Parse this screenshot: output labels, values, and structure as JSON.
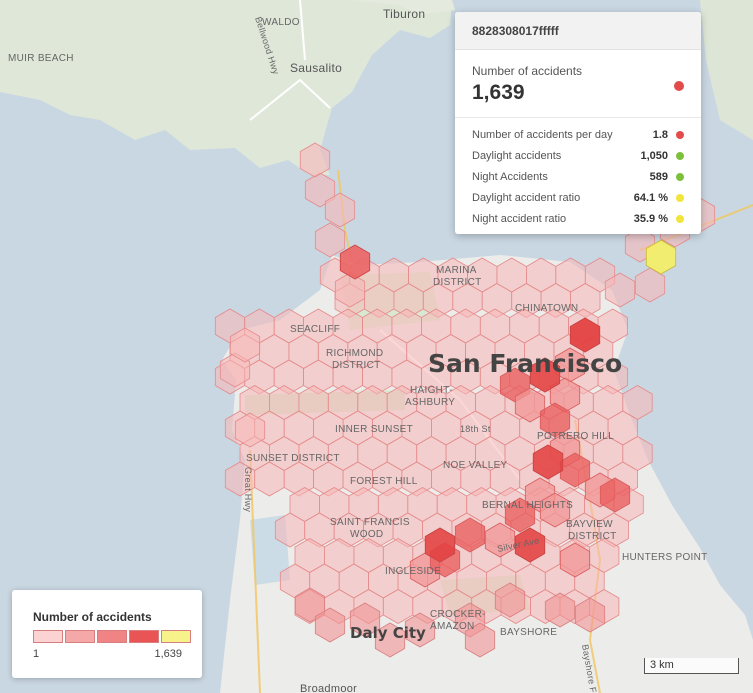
{
  "map": {
    "city_title": "San Francisco",
    "labels": {
      "muir_beach": "MUIR BEACH",
      "waldo": "WALDO",
      "sausalito": "Sausalito",
      "tiburon": "Tiburon",
      "bellwood_hwy": "Bellwood Hwy",
      "marina": "MARINA",
      "district": "DISTRICT",
      "chinatown": "CHINATOWN",
      "seacliff": "SEACLIFF",
      "richmond": "RICHMOND",
      "richmond_district": "DISTRICT",
      "haight": "HAIGHT-",
      "ashbury": "ASHBURY",
      "inner_sunset": "INNER SUNSET",
      "street_18th": "18th St",
      "potrero_hill": "POTRERO HILL",
      "sunset_district": "SUNSET DISTRICT",
      "noe_valley": "NOE VALLEY",
      "great_hwy": "Great Hwy",
      "forest_hill": "FOREST HILL",
      "bernal_heights": "BERNAL HEIGHTS",
      "saint_francis": "SAINT FRANCIS",
      "wood": "WOOD",
      "bayview": "BAYVIEW",
      "bayview_district": "DISTRICT",
      "silver_ave": "Silver Ave",
      "hunters_point": "HUNTERS POINT",
      "ingleside": "INGLESIDE",
      "crocker": "CROCKER-",
      "amazon": "AMAZON",
      "daly_city": "Daly City",
      "bayshore": "BAYSHORE",
      "bayshore_fwy": "Bayshore Fr",
      "broadmoor": "Broadmoor"
    }
  },
  "tooltip": {
    "cell_id": "8828308017fffff",
    "main_label": "Number of accidents",
    "main_value": "1,639",
    "main_color": "#e34b4b",
    "rows": [
      {
        "label": "Number of accidents per day",
        "value": "1.8",
        "color": "#e34b4b"
      },
      {
        "label": "Daylight accidents",
        "value": "1,050",
        "color": "#7cc03b"
      },
      {
        "label": "Night Accidents",
        "value": "589",
        "color": "#7cc03b"
      },
      {
        "label": "Daylight accident ratio",
        "value": "64.1 %",
        "color": "#f1e43a"
      },
      {
        "label": "Night accident ratio",
        "value": "35.9 %",
        "color": "#f1e43a"
      }
    ]
  },
  "legend": {
    "title": "Number of accidents",
    "min": "1",
    "max": "1,639",
    "colors": [
      "#fcd3d3",
      "#f5a8a8",
      "#f08383",
      "#e95555",
      "#f7f28a"
    ]
  },
  "scale": {
    "label": "3 km"
  }
}
